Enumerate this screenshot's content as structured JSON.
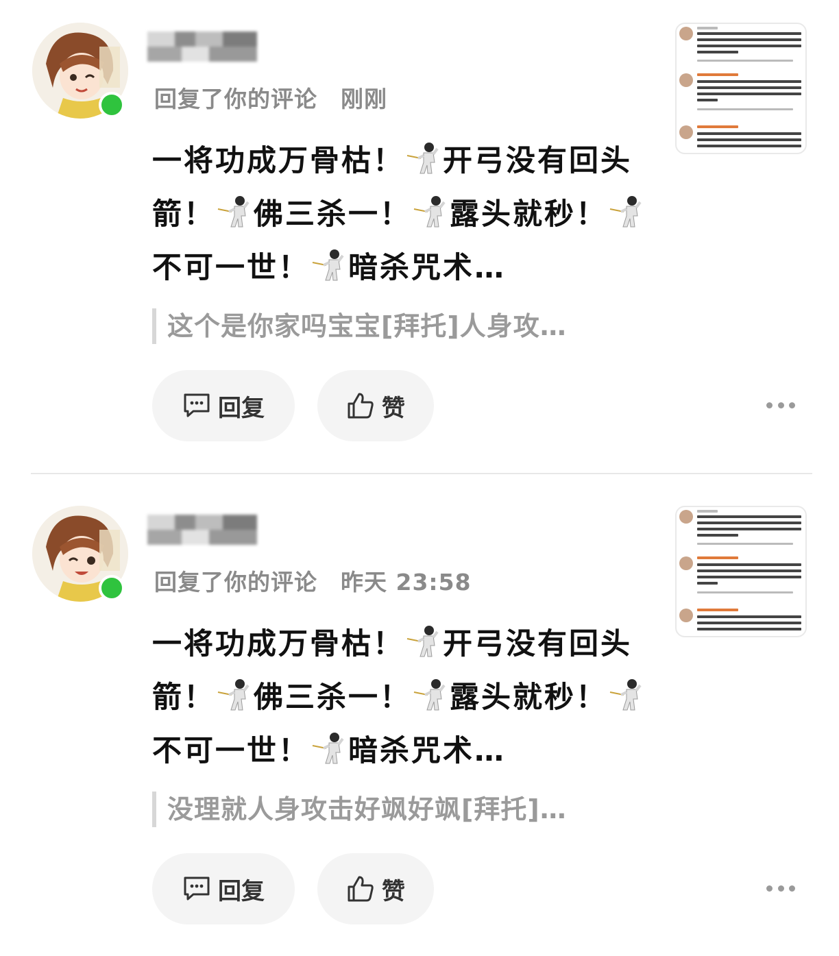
{
  "notifications": [
    {
      "meta_action": "回复了你的评论",
      "time": "刚刚",
      "content_parts": [
        "一将功成万骨枯！",
        "开弓没有回头箭！",
        "佛三杀一！",
        "露头就秒！",
        "不可一世！",
        "暗杀咒术…"
      ],
      "quote": "这个是你家吗宝宝[拜托]人身攻…",
      "reply_label": "回复",
      "like_label": "赞"
    },
    {
      "meta_action": "回复了你的评论",
      "time": "昨天 23:58",
      "content_parts": [
        "一将功成万骨枯！",
        "开弓没有回头箭！",
        "佛三杀一！",
        "露头就秒！",
        "不可一世！",
        "暗杀咒术…"
      ],
      "quote": "没理就人身攻击好飒好飒[拜托]…",
      "reply_label": "回复",
      "like_label": "赞"
    }
  ],
  "icons": {
    "emoji": "fencer-emoji",
    "reply": "comment-icon",
    "like": "thumbs-up-icon",
    "more": "more-dots-icon"
  },
  "colors": {
    "online": "#2fc33e",
    "meta": "#8a8a8a",
    "quote": "#9a9a9a",
    "button_bg": "#f4f4f4"
  }
}
